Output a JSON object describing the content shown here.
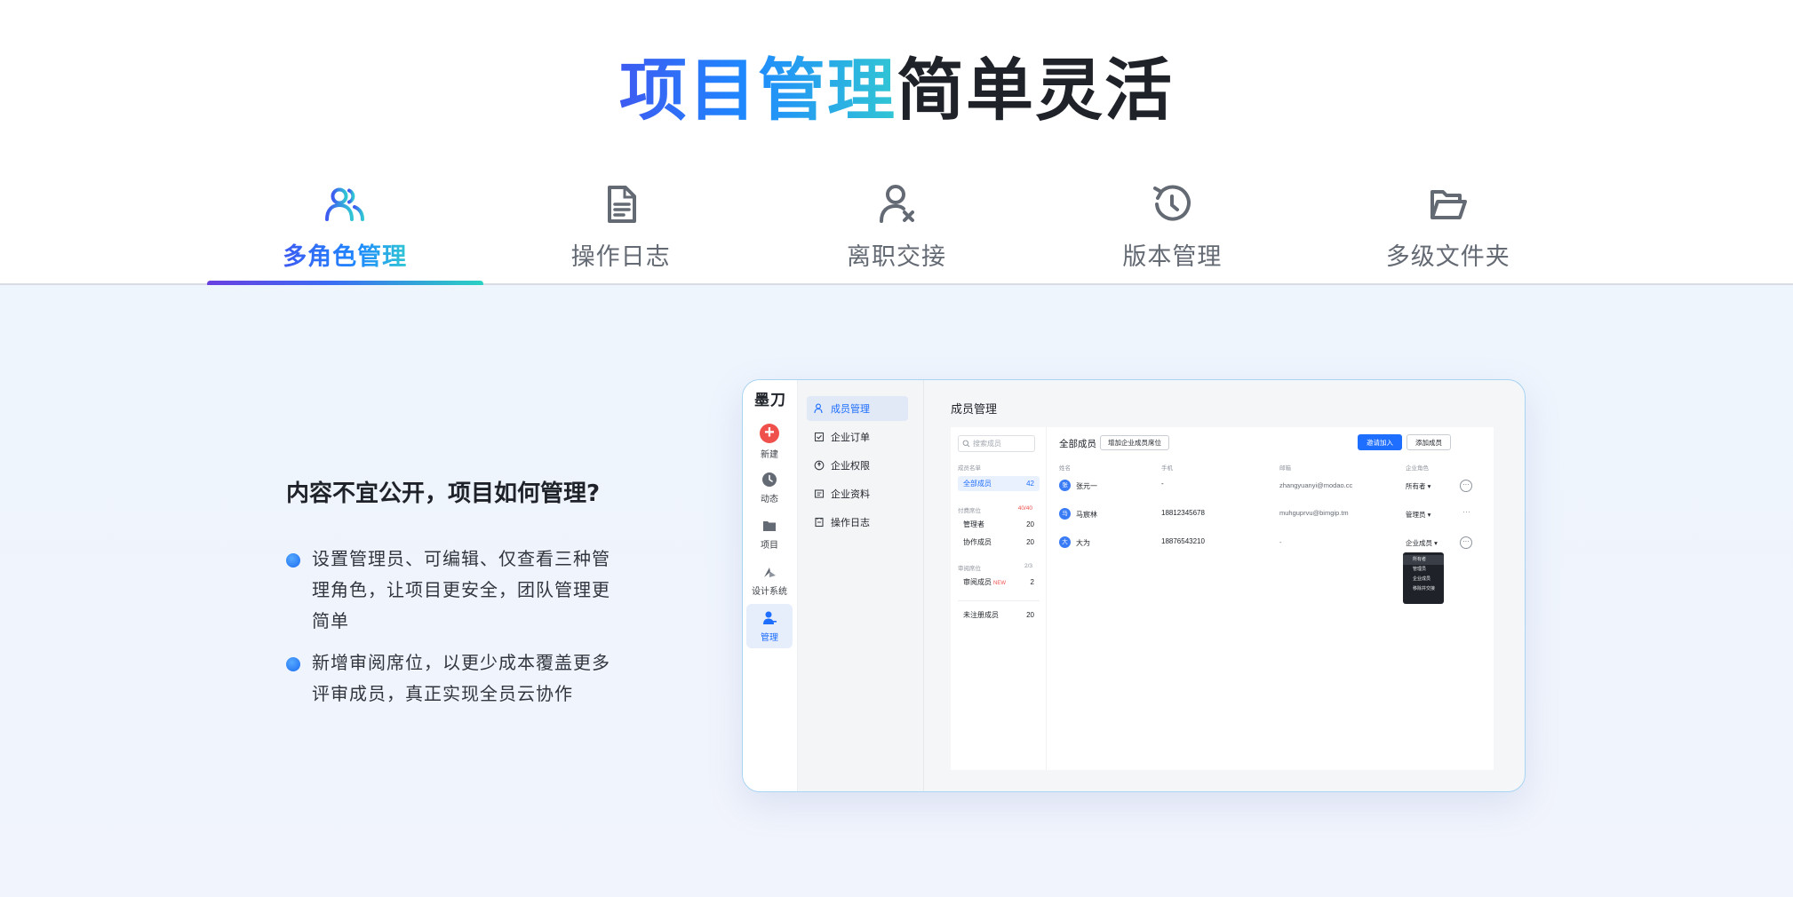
{
  "hero": {
    "title_highlight": "项目管理",
    "title_rest": "简单灵活"
  },
  "tabs": [
    {
      "label": "多角色管理",
      "icon": "users-icon",
      "active": true
    },
    {
      "label": "操作日志",
      "icon": "document-icon",
      "active": false
    },
    {
      "label": "离职交接",
      "icon": "user-remove-icon",
      "active": false
    },
    {
      "label": "版本管理",
      "icon": "history-icon",
      "active": false
    },
    {
      "label": "多级文件夹",
      "icon": "folder-open-icon",
      "active": false
    }
  ],
  "feature": {
    "question": "内容不宜公开，项目如何管理?",
    "bullets": [
      "设置管理员、可编辑、仅查看三种管理角色，让项目更安全，团队管理更简单",
      "新增审阅席位，以更少成本覆盖更多评审成员，真正实现全员云协作"
    ]
  },
  "app": {
    "logo": "墨刀",
    "rail": [
      {
        "label": "新建",
        "icon": "plus-icon"
      },
      {
        "label": "动态",
        "icon": "clock-icon"
      },
      {
        "label": "项目",
        "icon": "folder-icon"
      },
      {
        "label": "设计系统",
        "icon": "shapes-icon"
      },
      {
        "label": "管理",
        "icon": "admin-user-icon",
        "active": true
      }
    ],
    "submenu": [
      {
        "label": "成员管理",
        "active": true
      },
      {
        "label": "企业订单"
      },
      {
        "label": "企业权限"
      },
      {
        "label": "企业资料"
      },
      {
        "label": "操作日志"
      }
    ],
    "page_title": "成员管理",
    "members_list": {
      "search_placeholder": "搜索成员",
      "section_list": "成员名单",
      "all_members": {
        "label": "全部成员",
        "count": "42"
      },
      "paid_seats": {
        "label": "付费席位",
        "ratio": "40/40"
      },
      "admins": {
        "label": "管理者",
        "count": "20"
      },
      "collaborators": {
        "label": "协作成员",
        "count": "20"
      },
      "review_seats": {
        "label": "审阅席位",
        "ratio": "2/3"
      },
      "reviewers": {
        "label": "审阅成员",
        "badge": "NEW",
        "count": "2"
      },
      "unregistered": {
        "label": "未注册成员",
        "count": "20"
      }
    },
    "table": {
      "title": "全部成员",
      "add_seat_button": "增加企业成员席位",
      "invite_button": "邀请加入",
      "add_member_button": "添加成员",
      "headers": [
        "姓名",
        "手机",
        "邮箱",
        "企业角色"
      ],
      "rows": [
        {
          "avatar": "张",
          "name": "张元一",
          "phone": "-",
          "email": "zhangyuanyi@modao.cc",
          "role": "所有者"
        },
        {
          "avatar": "马",
          "name": "马宸林",
          "phone": "18812345678",
          "email": "muhguprvu@bimgip.tm",
          "role": "管理员"
        },
        {
          "avatar": "大",
          "name": "大为",
          "phone": "18876543210",
          "email": "-",
          "role": "企业成员"
        }
      ],
      "role_options": [
        "所有者",
        "管理员",
        "企业成员",
        "移除并交接"
      ]
    }
  },
  "colors": {
    "accent": "#1e6fff",
    "gradient_start": "#3d5af1",
    "gradient_end": "#31c6d4",
    "danger": "#f0504c"
  }
}
